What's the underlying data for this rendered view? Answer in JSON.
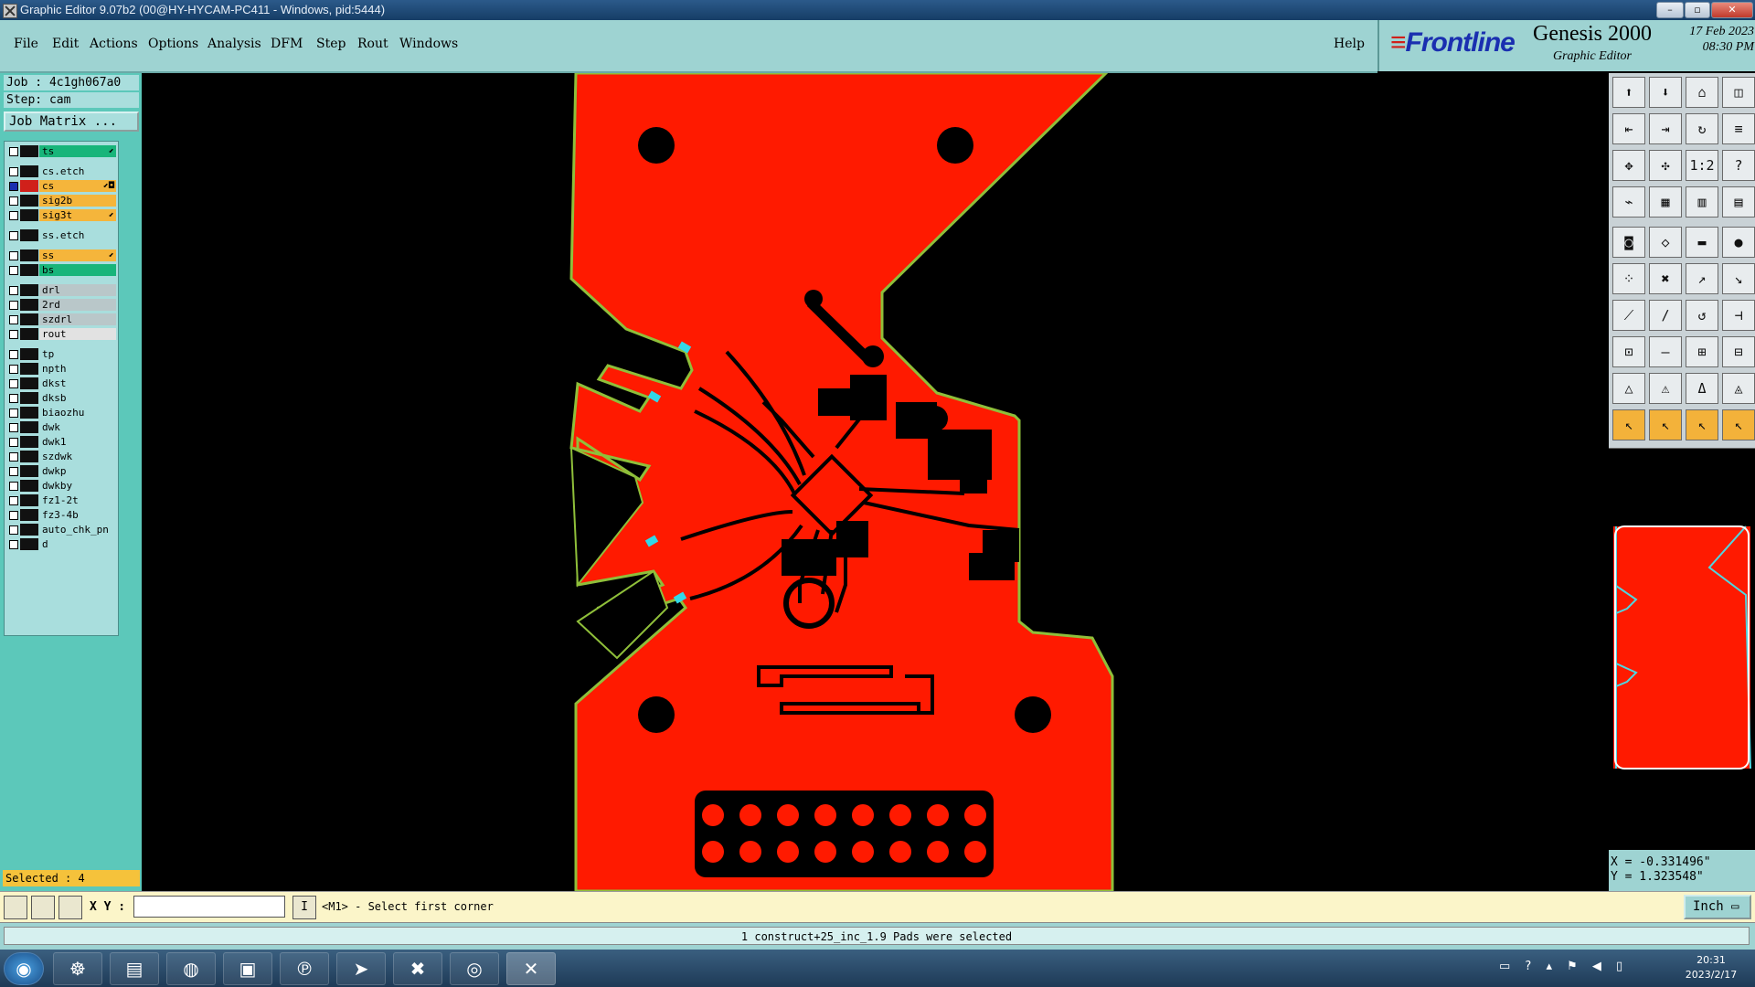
{
  "window": {
    "title": "Graphic Editor 9.07b2 (00@HY-HYCAM-PC411 - Windows, pid:5444)",
    "controls": {
      "minimize": "–",
      "maximize": "▫",
      "close": "✕"
    }
  },
  "menu": [
    "File",
    "Edit",
    "Actions",
    "Options",
    "Analysis",
    "DFM",
    "Step",
    "Rout",
    "Windows"
  ],
  "help": "Help",
  "brand": {
    "logo": "Frontline",
    "product": "Genesis 2000",
    "subtitle": "Graphic Editor",
    "date": "17 Feb 2023",
    "time": "08:30 PM"
  },
  "job": {
    "job_line": "Job : 4c1gh067a0",
    "step_line": "Step: cam",
    "matrix_button": "Job Matrix ..."
  },
  "layers": [
    {
      "name": "ts",
      "color": "#18b57a",
      "active": false,
      "flag": "⬋"
    },
    {
      "name": "cs.etch",
      "color": "#a9dedd",
      "active": false,
      "flag": ""
    },
    {
      "name": "cs",
      "color": "#f5b53b",
      "active": true,
      "flag": "⬋◘"
    },
    {
      "name": "sig2b",
      "color": "#f5b53b",
      "active": false,
      "flag": ""
    },
    {
      "name": "sig3t",
      "color": "#f5b53b",
      "active": false,
      "flag": "⬋"
    },
    {
      "name": "ss.etch",
      "color": "#a9dedd",
      "active": false,
      "flag": ""
    },
    {
      "name": "ss",
      "color": "#f5b53b",
      "active": false,
      "flag": "⬋"
    },
    {
      "name": "bs",
      "color": "#18b57a",
      "active": false,
      "flag": ""
    },
    {
      "name": "drl",
      "color": "#b9c7c9",
      "active": false,
      "flag": ""
    },
    {
      "name": "2rd",
      "color": "#b9c7c9",
      "active": false,
      "flag": ""
    },
    {
      "name": "szdrl",
      "color": "#b9c7c9",
      "active": false,
      "flag": ""
    },
    {
      "name": "rout",
      "color": "#e2e2e2",
      "active": false,
      "flag": ""
    },
    {
      "name": "tp",
      "color": "#a9dedd",
      "active": false,
      "flag": ""
    },
    {
      "name": "npth",
      "color": "#a9dedd",
      "active": false,
      "flag": ""
    },
    {
      "name": "dkst",
      "color": "#a9dedd",
      "active": false,
      "flag": ""
    },
    {
      "name": "dksb",
      "color": "#a9dedd",
      "active": false,
      "flag": ""
    },
    {
      "name": "biaozhu",
      "color": "#a9dedd",
      "active": false,
      "flag": ""
    },
    {
      "name": "dwk",
      "color": "#a9dedd",
      "active": false,
      "flag": ""
    },
    {
      "name": "dwk1",
      "color": "#a9dedd",
      "active": false,
      "flag": ""
    },
    {
      "name": "szdwk",
      "color": "#a9dedd",
      "active": false,
      "flag": ""
    },
    {
      "name": "dwkp",
      "color": "#a9dedd",
      "active": false,
      "flag": ""
    },
    {
      "name": "dwkby",
      "color": "#a9dedd",
      "active": false,
      "flag": ""
    },
    {
      "name": "fz1-2t",
      "color": "#a9dedd",
      "active": false,
      "flag": ""
    },
    {
      "name": "fz3-4b",
      "color": "#a9dedd",
      "active": false,
      "flag": ""
    },
    {
      "name": "auto_chk_pn",
      "color": "#a9dedd",
      "active": false,
      "flag": ""
    },
    {
      "name": "d",
      "color": "#a9dedd",
      "active": false,
      "flag": ""
    }
  ],
  "selected": "Selected : 4",
  "coords": {
    "x": "X = -0.331496\"",
    "y": "Y = 1.323548\""
  },
  "command": {
    "xy_label": "X Y :",
    "input_value": "",
    "cursor_glyph": "I",
    "prompt": "<M1> - Select first corner",
    "unit": "Inch"
  },
  "status": "1 construct+25_inc_1.9 Pads were selected",
  "taskbar": {
    "time": "20:31",
    "date": "2023/2/17"
  },
  "colors": {
    "board": "#ff1a00",
    "outline": "#8fbf3a",
    "panel": "#9ed3d2",
    "layer_bg": "#5cc8ba"
  }
}
